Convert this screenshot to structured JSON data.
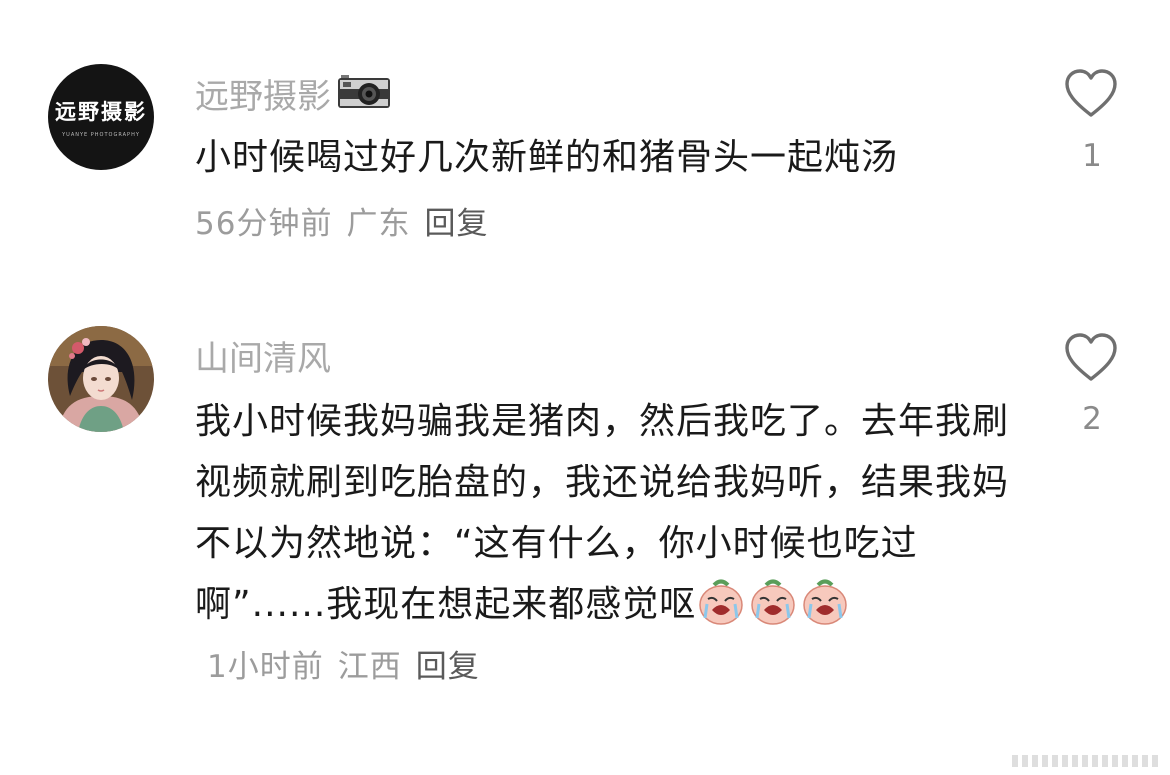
{
  "comments": [
    {
      "username": "远野摄影",
      "avatar_text": "远野摄影",
      "avatar_subtext": "YUANYE PHOTOGRAPHY",
      "text": "小时候喝过好几次新鲜的和猪骨头一起炖汤",
      "time": "56分钟前",
      "location": "广东",
      "reply_label": "回复",
      "likes": "1",
      "username_icon": "camera-icon"
    },
    {
      "username": "山间清风",
      "avatar_icon": "anime-girl-avatar",
      "text": "我小时候我妈骗我是猪肉，然后我吃了。去年我刷视频就刷到吃胎盘的，我还说给我妈听，结果我妈不以为然地说：“这有什么，你小时候也吃过啊”......我现在想起来都感觉呕",
      "emojis": [
        "crying-face-emoji",
        "crying-face-emoji",
        "crying-face-emoji"
      ],
      "time": "1小时前",
      "location": "江西",
      "reply_label": "回复",
      "likes": "2"
    }
  ],
  "colors": {
    "username": "#a9a9a9",
    "text": "#1a1a1a",
    "meta": "#9c9c9c"
  }
}
